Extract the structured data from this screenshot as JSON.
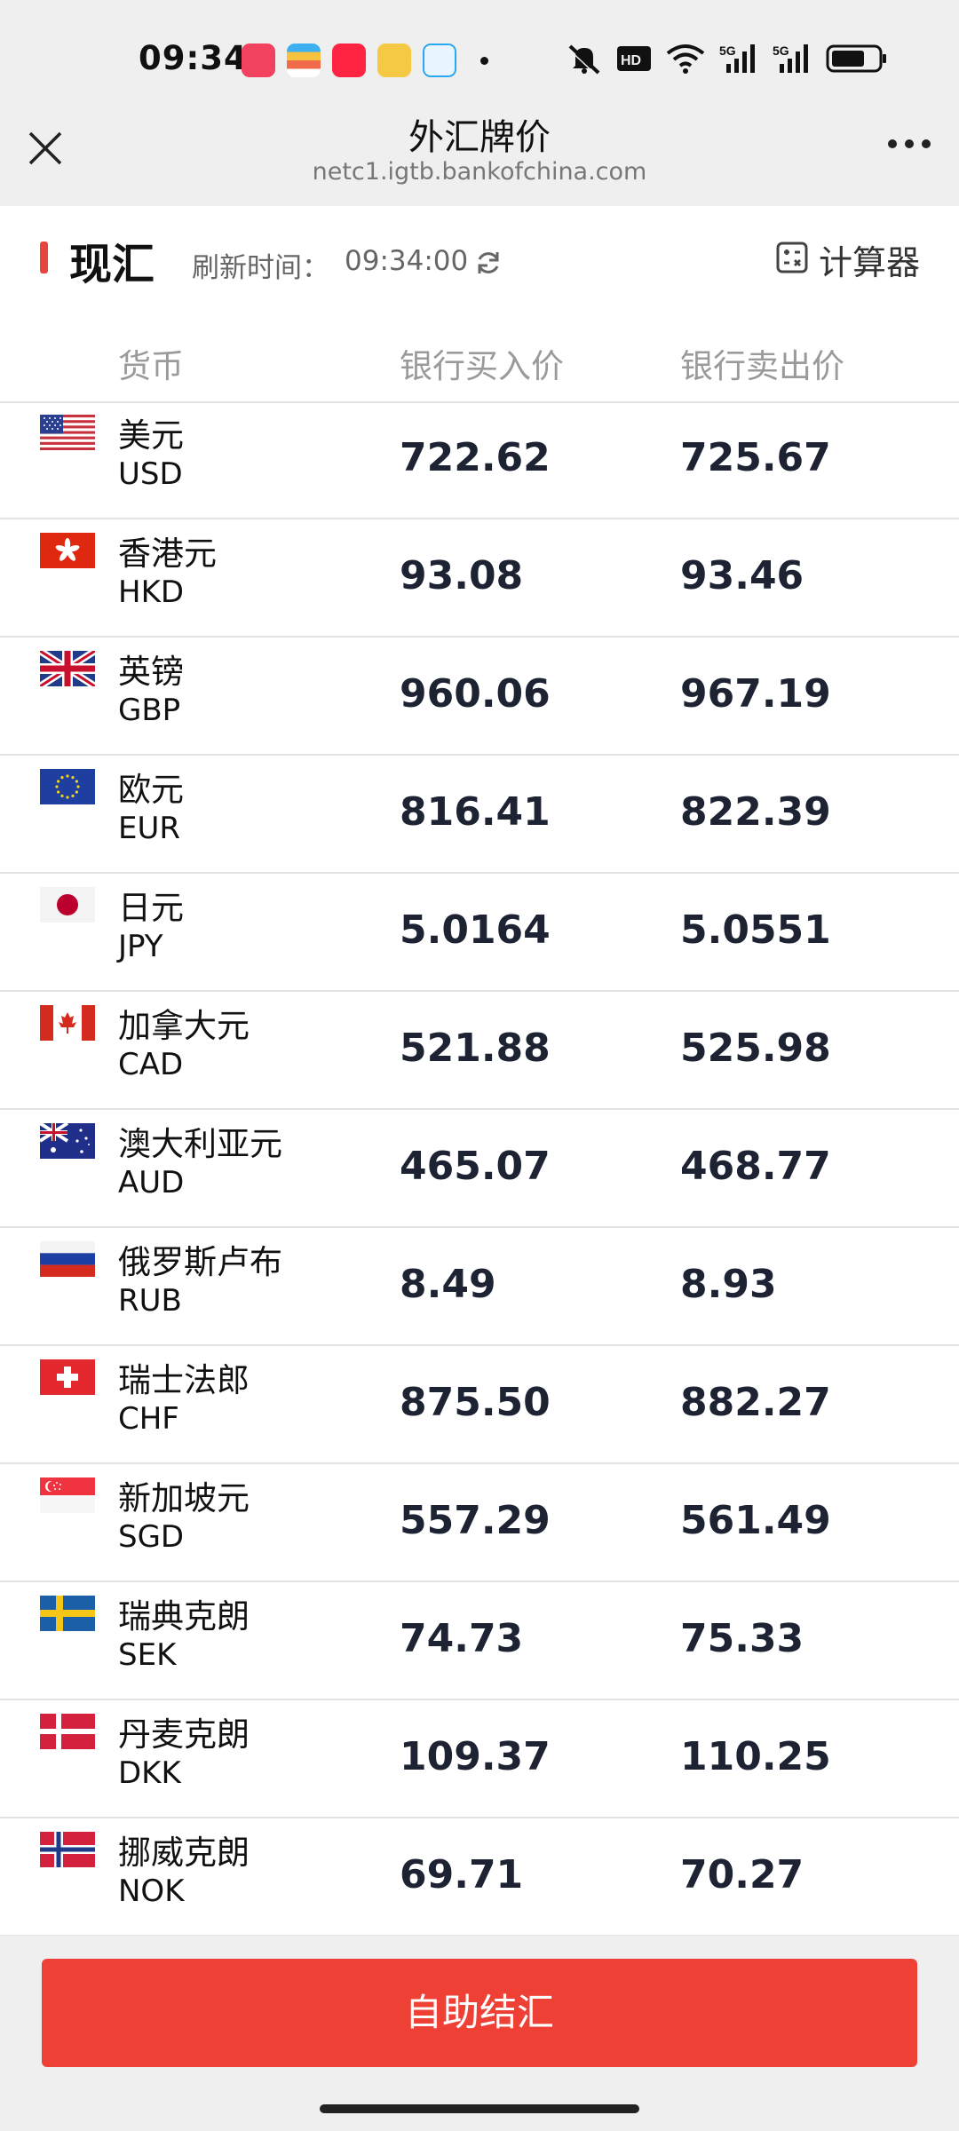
{
  "status_bar": {
    "time": "09:34",
    "app_icons": [
      "music-app-icon",
      "wallet-app-icon",
      "xiaohongshu-app-icon",
      "notes-app-icon",
      "chat-app-icon"
    ],
    "system_icons": [
      "mute-icon",
      "hd-icon",
      "wifi-icon",
      "signal-5g-icon",
      "signal-5g-icon",
      "battery-icon"
    ]
  },
  "navbar": {
    "title": "外汇牌价",
    "url": "netc1.igtb.bankofchina.com"
  },
  "section": {
    "title": "现汇",
    "refresh_label": "刷新时间：",
    "refresh_time": "09:34:00",
    "calculator_label": "计算器",
    "accent_color": "#e8463c"
  },
  "table": {
    "headers": {
      "currency": "货币",
      "buy": "银行买入价",
      "sell": "银行卖出价"
    },
    "rows": [
      {
        "name": "美元",
        "code": "USD",
        "buy": "722.62",
        "sell": "725.67",
        "flag": "us-flag-icon"
      },
      {
        "name": "香港元",
        "code": "HKD",
        "buy": "93.08",
        "sell": "93.46",
        "flag": "hk-flag-icon"
      },
      {
        "name": "英镑",
        "code": "GBP",
        "buy": "960.06",
        "sell": "967.19",
        "flag": "uk-flag-icon"
      },
      {
        "name": "欧元",
        "code": "EUR",
        "buy": "816.41",
        "sell": "822.39",
        "flag": "eu-flag-icon"
      },
      {
        "name": "日元",
        "code": "JPY",
        "buy": "5.0164",
        "sell": "5.0551",
        "flag": "jp-flag-icon"
      },
      {
        "name": "加拿大元",
        "code": "CAD",
        "buy": "521.88",
        "sell": "525.98",
        "flag": "ca-flag-icon"
      },
      {
        "name": "澳大利亚元",
        "code": "AUD",
        "buy": "465.07",
        "sell": "468.77",
        "flag": "au-flag-icon"
      },
      {
        "name": "俄罗斯卢布",
        "code": "RUB",
        "buy": "8.49",
        "sell": "8.93",
        "flag": "ru-flag-icon"
      },
      {
        "name": "瑞士法郎",
        "code": "CHF",
        "buy": "875.50",
        "sell": "882.27",
        "flag": "ch-flag-icon"
      },
      {
        "name": "新加坡元",
        "code": "SGD",
        "buy": "557.29",
        "sell": "561.49",
        "flag": "sg-flag-icon"
      },
      {
        "name": "瑞典克朗",
        "code": "SEK",
        "buy": "74.73",
        "sell": "75.33",
        "flag": "se-flag-icon"
      },
      {
        "name": "丹麦克朗",
        "code": "DKK",
        "buy": "109.37",
        "sell": "110.25",
        "flag": "dk-flag-icon"
      },
      {
        "name": "挪威克朗",
        "code": "NOK",
        "buy": "69.71",
        "sell": "70.27",
        "flag": "no-flag-icon"
      }
    ]
  },
  "bottom": {
    "button_label": "自助结汇",
    "button_color": "#ee4035"
  }
}
